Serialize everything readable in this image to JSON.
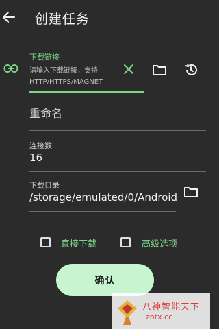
{
  "header": {
    "title": "创建任务"
  },
  "download_link": {
    "label": "下载链接",
    "placeholder_line1": "请输入下载链接，支持",
    "placeholder_line2": "HTTP/HTTPS/MAGNET"
  },
  "rename": {
    "placeholder": "重命名"
  },
  "connections": {
    "label": "连接数",
    "value": "16"
  },
  "directory": {
    "label": "下载目录",
    "value": "/storage/emulated/0/Android"
  },
  "options": {
    "direct_download": {
      "label": "直接下载",
      "checked": false
    },
    "advanced": {
      "label": "高级选项",
      "checked": false
    }
  },
  "confirm": {
    "label": "确认"
  },
  "watermark": {
    "line1": "八神智能天下",
    "line2": "zntx.cc"
  },
  "colors": {
    "accent": "#7fd48a",
    "background": "#2b2b2b",
    "button": "#c8f5cf"
  }
}
